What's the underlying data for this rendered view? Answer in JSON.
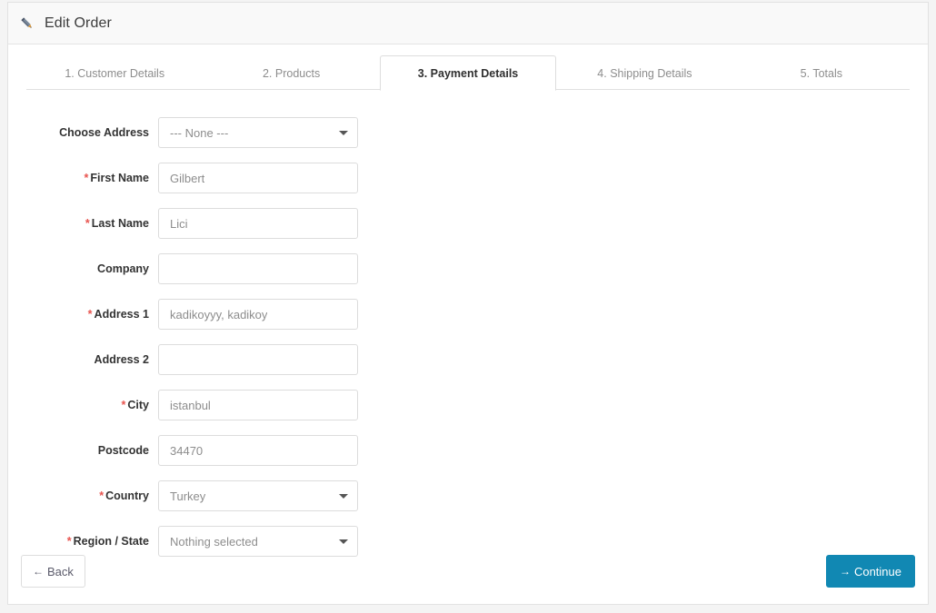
{
  "header": {
    "icon": "pencil-icon",
    "title": "Edit Order"
  },
  "tabs": [
    {
      "label": "1. Customer Details",
      "active": false
    },
    {
      "label": "2. Products",
      "active": false
    },
    {
      "label": "3. Payment Details",
      "active": true
    },
    {
      "label": "4. Shipping Details",
      "active": false
    },
    {
      "label": "5. Totals",
      "active": false
    }
  ],
  "form": {
    "fields": [
      {
        "label": "Choose Address",
        "required": false,
        "type": "select",
        "value": "--- None ---"
      },
      {
        "label": "First Name",
        "required": true,
        "type": "text",
        "value": "Gilbert"
      },
      {
        "label": "Last Name",
        "required": true,
        "type": "text",
        "value": "Lici"
      },
      {
        "label": "Company",
        "required": false,
        "type": "text",
        "value": ""
      },
      {
        "label": "Address 1",
        "required": true,
        "type": "text",
        "value": "kadikoyyy, kadikoy"
      },
      {
        "label": "Address 2",
        "required": false,
        "type": "text",
        "value": ""
      },
      {
        "label": "City",
        "required": true,
        "type": "text",
        "value": "istanbul"
      },
      {
        "label": "Postcode",
        "required": false,
        "type": "text",
        "value": "34470"
      },
      {
        "label": "Country",
        "required": true,
        "type": "select",
        "value": "Turkey"
      },
      {
        "label": "Region / State",
        "required": true,
        "type": "select",
        "value": "Nothing selected"
      }
    ]
  },
  "footer": {
    "back_label": "Back",
    "back_icon": "arrow-left-icon",
    "continue_label": "Continue",
    "continue_icon": "arrow-right-icon"
  },
  "colors": {
    "accent": "#1188b3",
    "required_marker": "#e8544f",
    "panel_bg": "#ffffff",
    "page_bg": "#f4f4f4",
    "header_bg": "#f9f9f9",
    "border": "#dddddd"
  },
  "glyphs": {
    "arrow_left": "←",
    "arrow_right": "→",
    "asterisk": "*"
  }
}
